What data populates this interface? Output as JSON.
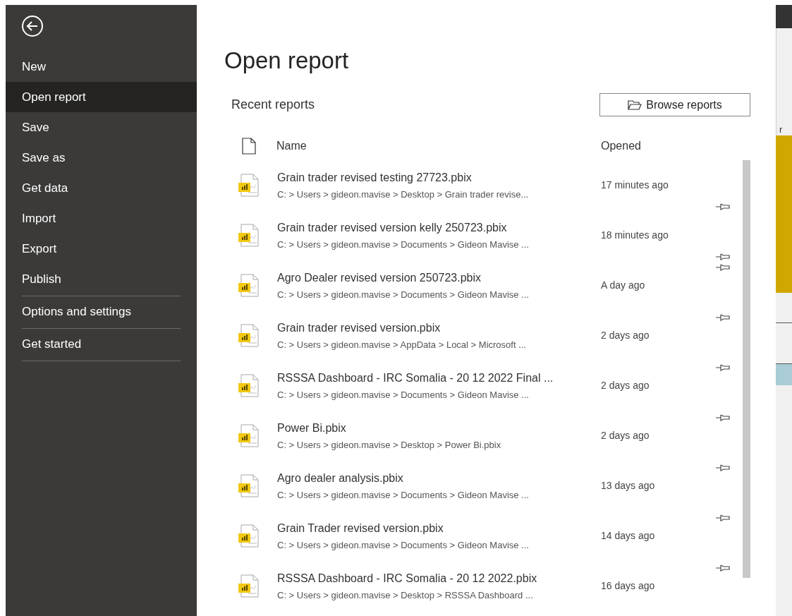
{
  "sidebar": {
    "items": [
      {
        "label": "New",
        "selected": false,
        "divider_after": false
      },
      {
        "label": "Open report",
        "selected": true,
        "divider_after": false
      },
      {
        "label": "Save",
        "selected": false,
        "divider_after": false
      },
      {
        "label": "Save as",
        "selected": false,
        "divider_after": false
      },
      {
        "label": "Get data",
        "selected": false,
        "divider_after": false
      },
      {
        "label": "Import",
        "selected": false,
        "divider_after": false
      },
      {
        "label": "Export",
        "selected": false,
        "divider_after": false
      },
      {
        "label": "Publish",
        "selected": false,
        "divider_after": true
      },
      {
        "label": "Options and settings",
        "selected": false,
        "divider_after": true
      },
      {
        "label": "Get started",
        "selected": false,
        "divider_after": true
      }
    ]
  },
  "title": "Open report",
  "section_title": "Recent reports",
  "browse_button": "Browse reports",
  "table": {
    "columns": [
      "Name",
      "Opened"
    ],
    "rows": [
      {
        "name": "Grain trader revised testing 27723.pbix",
        "path": "C: > Users > gideon.mavise > Desktop > Grain trader revise...",
        "opened": "17 minutes ago"
      },
      {
        "name": "Grain trader revised version kelly 250723.pbix",
        "path": "C: > Users > gideon.mavise > Documents > Gideon Mavise ...",
        "opened": "18 minutes ago"
      },
      {
        "name": "Agro Dealer revised version 250723.pbix",
        "path": "C: > Users > gideon.mavise > Documents > Gideon Mavise ...",
        "opened": "A day ago"
      },
      {
        "name": "Grain trader revised version.pbix",
        "path": "C: > Users > gideon.mavise > AppData > Local > Microsoft ...",
        "opened": "2 days ago"
      },
      {
        "name": "RSSSA Dashboard - IRC Somalia - 20 12 2022 Final ...",
        "path": "C: > Users > gideon.mavise > Documents > Gideon Mavise ...",
        "opened": "2 days ago"
      },
      {
        "name": "Power Bi.pbix",
        "path": "C: > Users > gideon.mavise > Desktop > Power Bi.pbix",
        "opened": "2 days ago"
      },
      {
        "name": "Agro dealer analysis.pbix",
        "path": "C: > Users > gideon.mavise > Documents > Gideon Mavise ...",
        "opened": "13 days ago"
      },
      {
        "name": "Grain Trader revised version.pbix",
        "path": "C: > Users > gideon.mavise > Documents > Gideon Mavise ...",
        "opened": "14 days ago"
      },
      {
        "name": "RSSSA Dashboard - IRC Somalia - 20 12 2022.pbix",
        "path": "C: > Users > gideon.mavise > Desktop > RSSSA Dashboard ...",
        "opened": "16 days ago"
      }
    ]
  },
  "background_app": {
    "fragment": "r"
  }
}
